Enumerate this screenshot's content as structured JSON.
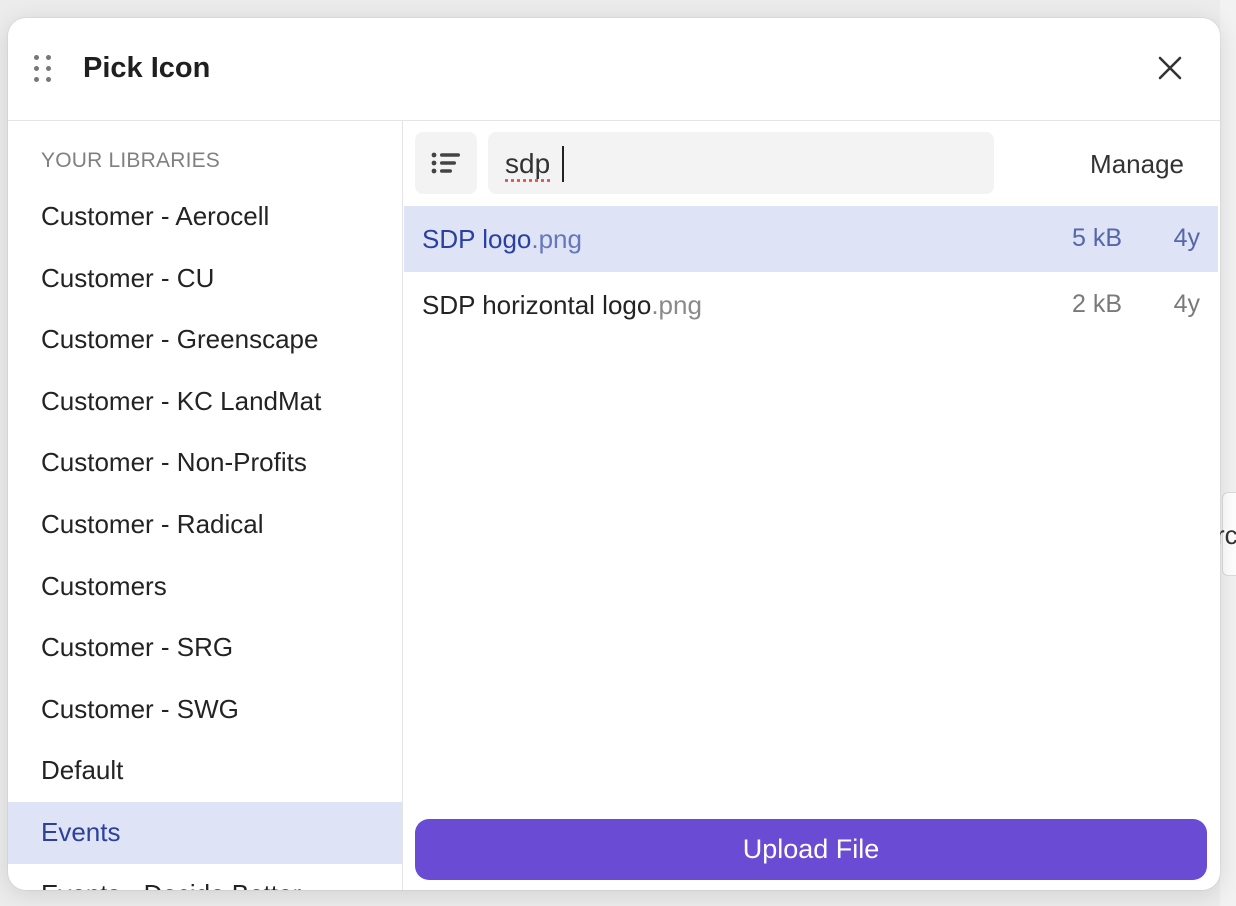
{
  "background": {
    "partial_text": "rc"
  },
  "dialog": {
    "title": "Pick Icon",
    "drag_icon": "drag-handle-icon",
    "close_icon": "close-icon"
  },
  "sidebar": {
    "heading": "YOUR LIBRARIES",
    "items": [
      {
        "label": "Customer - Aerocell"
      },
      {
        "label": "Customer - CU"
      },
      {
        "label": "Customer - Greenscape"
      },
      {
        "label": "Customer - KC LandMat"
      },
      {
        "label": "Customer - Non-Profits"
      },
      {
        "label": "Customer - Radical"
      },
      {
        "label": "Customers"
      },
      {
        "label": "Customer - SRG"
      },
      {
        "label": "Customer - SWG"
      },
      {
        "label": "Default"
      },
      {
        "label": "Events",
        "active": true
      },
      {
        "label": "Events - Decide Better"
      }
    ]
  },
  "toolbar": {
    "view_icon": "list-view-icon",
    "search_value": "sdp",
    "manage_label": "Manage"
  },
  "files": [
    {
      "name": "SDP logo",
      "ext": ".png",
      "size": "5 kB",
      "age": "4y",
      "selected": true
    },
    {
      "name": "SDP horizontal logo",
      "ext": ".png",
      "size": "2 kB",
      "age": "4y",
      "selected": false
    }
  ],
  "upload": {
    "label": "Upload File"
  },
  "colors": {
    "accent": "#6a4bd3",
    "selection_bg": "#dfe3f6",
    "selection_text": "#2a41a0"
  }
}
